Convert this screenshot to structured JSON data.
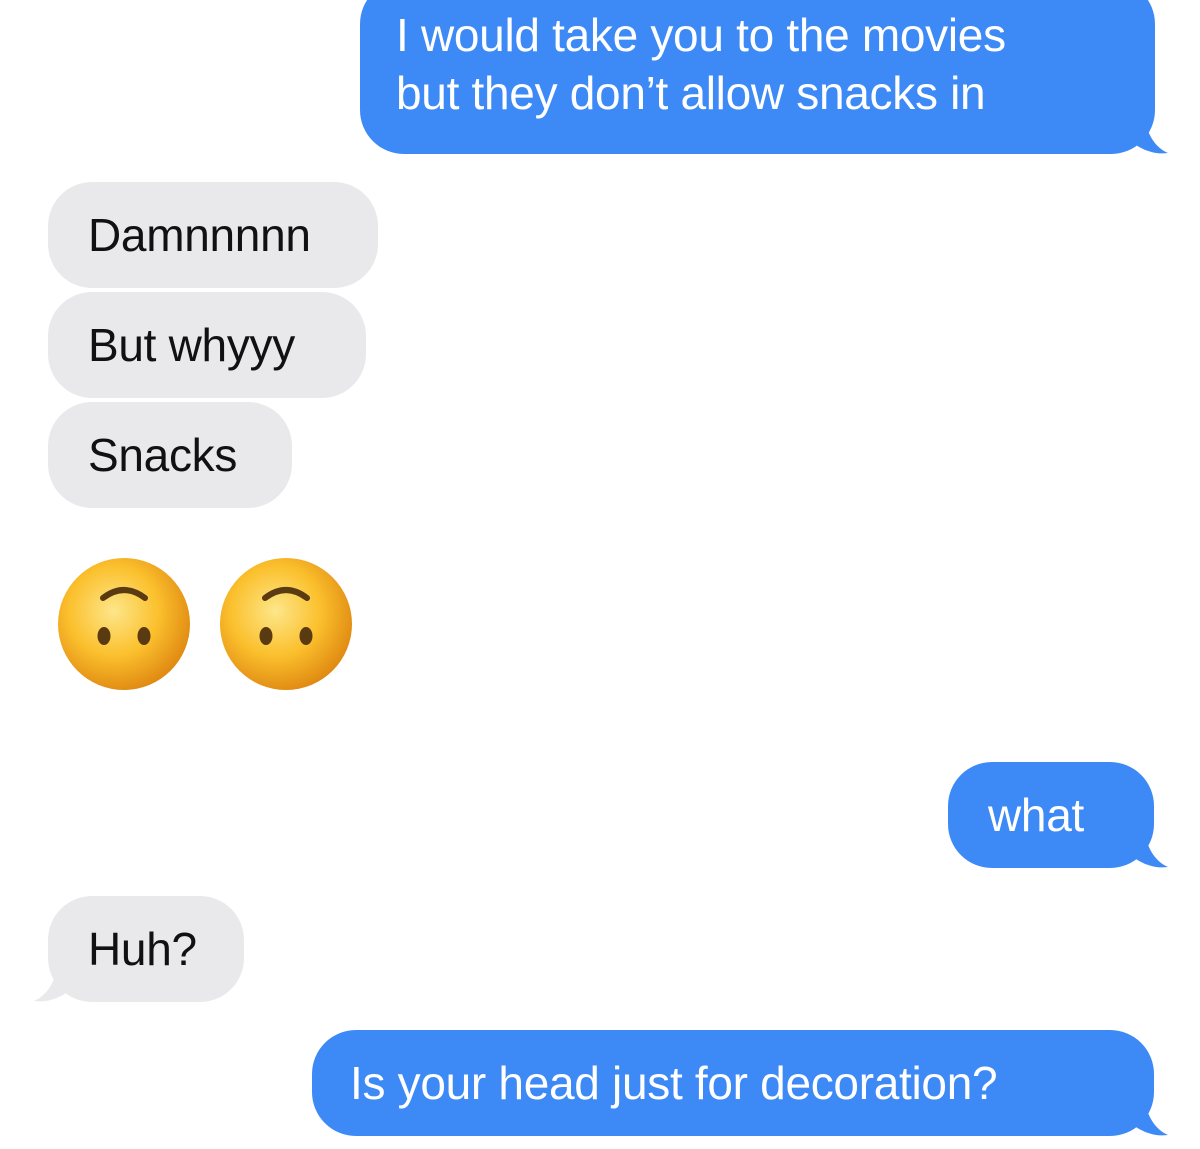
{
  "messages": [
    {
      "id": "m1",
      "direction": "sent",
      "lines": [
        "I would take you to the movies",
        "but they don’t allow snacks in"
      ]
    },
    {
      "id": "m2",
      "direction": "received",
      "text": "Damnnnnn"
    },
    {
      "id": "m3",
      "direction": "received",
      "text": "But whyyy"
    },
    {
      "id": "m4",
      "direction": "received",
      "text": "Snacks"
    },
    {
      "id": "m5",
      "direction": "received",
      "emoji": [
        "upside-down-face",
        "upside-down-face"
      ]
    },
    {
      "id": "m6",
      "direction": "sent",
      "text": "what"
    },
    {
      "id": "m7",
      "direction": "received",
      "text": "Huh?"
    },
    {
      "id": "m8",
      "direction": "sent",
      "text": "Is your head just for decoration?"
    }
  ],
  "colors": {
    "sent_bubble": "#3d8af7",
    "received_bubble": "#e9e9eb",
    "background": "#ffffff"
  }
}
